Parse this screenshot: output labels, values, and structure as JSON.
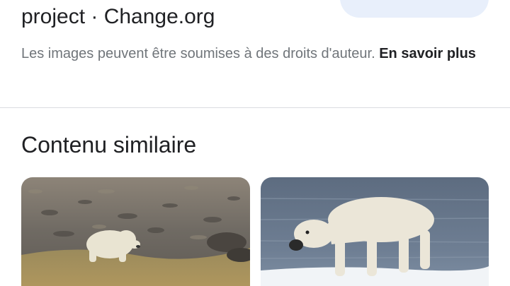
{
  "result": {
    "title": "project · Change.org",
    "copyright_text": "Les images peuvent être soumises à des droits d'auteur. ",
    "learn_more": "En savoir plus"
  },
  "similar": {
    "heading": "Contenu similaire",
    "thumbnails": [
      {
        "subject": "polar bear on rocky tundra"
      },
      {
        "subject": "polar bear on ice by sea"
      }
    ]
  },
  "colors": {
    "title_text": "#202124",
    "muted_text": "#70757a",
    "divider": "#dadce0",
    "pill_bg": "#e8effb"
  }
}
